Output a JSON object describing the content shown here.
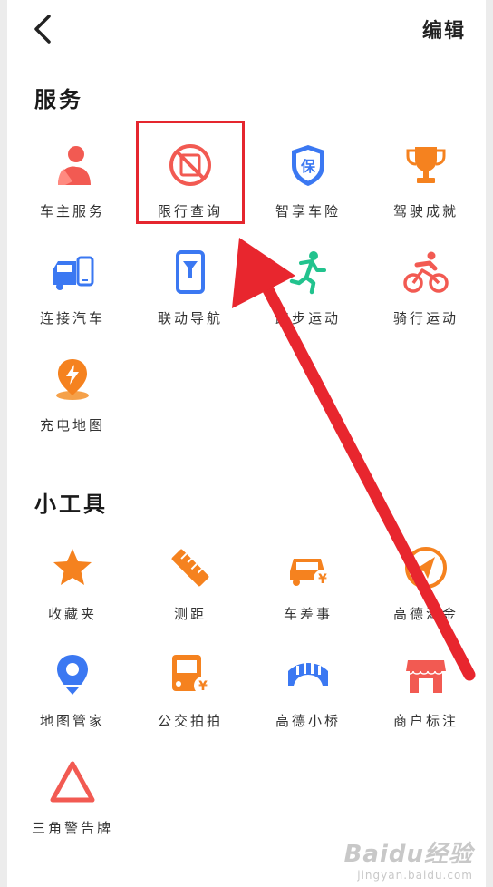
{
  "header": {
    "edit_label": "编辑"
  },
  "services": {
    "title": "服务",
    "items": [
      {
        "label": "车主服务",
        "icon": "car-owner-icon"
      },
      {
        "label": "限行查询",
        "icon": "traffic-restriction-icon"
      },
      {
        "label": "智享车险",
        "icon": "car-insurance-icon"
      },
      {
        "label": "驾驶成就",
        "icon": "trophy-icon"
      },
      {
        "label": "连接汽车",
        "icon": "car-connect-icon"
      },
      {
        "label": "联动导航",
        "icon": "phone-navigation-icon"
      },
      {
        "label": "跑步运动",
        "icon": "running-icon"
      },
      {
        "label": "骑行运动",
        "icon": "cycling-icon"
      },
      {
        "label": "充电地图",
        "icon": "charging-map-icon"
      }
    ]
  },
  "tools": {
    "title": "小工具",
    "items": [
      {
        "label": "收藏夹",
        "icon": "star-icon"
      },
      {
        "label": "测距",
        "icon": "ruler-icon"
      },
      {
        "label": "车差事",
        "icon": "car-errand-icon"
      },
      {
        "label": "高德淘金",
        "icon": "gold-rush-icon"
      },
      {
        "label": "地图管家",
        "icon": "map-pin-icon"
      },
      {
        "label": "公交拍拍",
        "icon": "bus-icon"
      },
      {
        "label": "高德小桥",
        "icon": "bridge-icon"
      },
      {
        "label": "商户标注",
        "icon": "store-icon"
      },
      {
        "label": "三角警告牌",
        "icon": "warning-triangle-icon"
      }
    ]
  },
  "watermark": {
    "logo": "Baidu经验",
    "url": "jingyan.baidu.com"
  },
  "colors": {
    "orange": "#f5821f",
    "red": "#f25a52",
    "blue": "#3b78f2",
    "green": "#22c38e",
    "highlight": "#e5262e"
  }
}
